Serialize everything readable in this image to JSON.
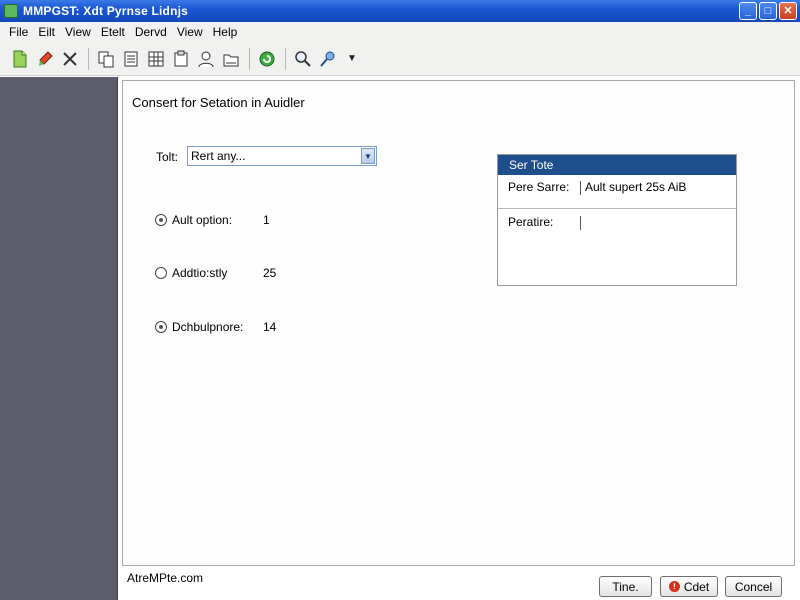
{
  "window": {
    "title": "MMPGST: Xdt Pyrnse Lidnjs"
  },
  "menu": [
    "File",
    "Eilt",
    "View",
    "Etelt",
    "Dervd",
    "View",
    "Help"
  ],
  "toolbar_icons": [
    "new-file-icon",
    "brush-icon",
    "cut-icon",
    "copy-icon",
    "document-icon",
    "grid-icon",
    "clipboard-icon",
    "user-icon",
    "folder-icon",
    "refresh-icon",
    "search-icon",
    "link-icon",
    "dropdown-icon"
  ],
  "main": {
    "heading": "Consert for Setation in Auidler",
    "field": {
      "label": "Tolt:",
      "value": "Rert any..."
    },
    "options": [
      {
        "label": "Ault option:",
        "value": "1"
      },
      {
        "label": "Addtio:stly",
        "value": "25"
      },
      {
        "label": "Dchbulpnore:",
        "value": "14"
      }
    ]
  },
  "settings_box": {
    "title": "Ser Tote",
    "rows": [
      {
        "label": "Pere Sarre:",
        "value": "Ault supert 25s AiB"
      },
      {
        "label": "Peratire:",
        "value": ""
      }
    ]
  },
  "footer": {
    "link": "AtreMPte.com",
    "buttons": {
      "time": "Tine.",
      "eject": "Cdet",
      "cancel": "Concel"
    }
  }
}
